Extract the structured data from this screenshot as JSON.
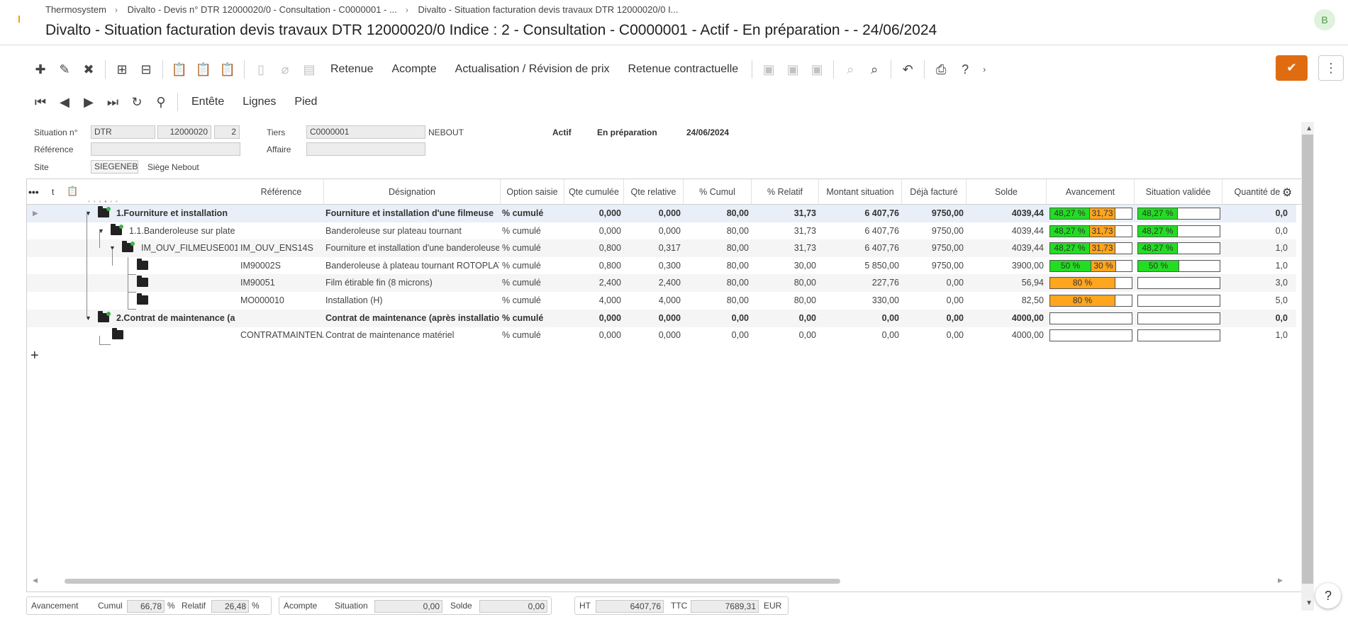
{
  "breadcrumb": [
    "Thermosystem",
    "Divalto - Devis n° DTR 12000020/0 - Consultation - C0000001 - ...",
    "Divalto - Situation facturation devis travaux DTR 12000020/0 I..."
  ],
  "title": "Divalto - Situation facturation devis travaux DTR 12000020/0 Indice : 2 - Consultation - C0000001 - Actif - En préparation - - 24/06/2024",
  "user_initial": "B",
  "toolbar1": {
    "retenue": "Retenue",
    "acompte": "Acompte",
    "actualisation": "Actualisation / Révision de prix",
    "retenue_contractuelle": "Retenue contractuelle"
  },
  "toolbar2": {
    "entete": "Entête",
    "lignes": "Lignes",
    "pied": "Pied"
  },
  "form": {
    "situation_label": "Situation n°",
    "situation_type": "DTR",
    "situation_num": "12000020",
    "situation_index": "2",
    "tiers_label": "Tiers",
    "tiers_code": "C0000001",
    "tiers_name": "NEBOUT",
    "status1": "Actif",
    "status2": "En préparation",
    "date": "24/06/2024",
    "reference_label": "Référence",
    "reference_value": "",
    "affaire_label": "Affaire",
    "affaire_value": "",
    "site_label": "Site",
    "site_code": "SIEGENEB",
    "site_name": "Siège Nebout"
  },
  "grid": {
    "tool_labels": {
      "more": "•••",
      "t": "t"
    },
    "columns": [
      "Référence",
      "Désignation",
      "Option saisie",
      "Qte cumulée",
      "Qte relative",
      "% Cumul",
      "% Relatif",
      "Montant situation",
      "Déjà facturé",
      "Solde",
      "Avancement",
      "Situation validée",
      "Quantité de"
    ],
    "rows": [
      {
        "tree": "1.Fourniture et installation",
        "ref": "",
        "des": "Fourniture et installation d'une filmeuse",
        "opt": "% cumulé",
        "qc": "0,000",
        "qr": "0,000",
        "pc": "80,00",
        "pr": "31,73",
        "mont": "6 407,76",
        "deja": "9750,00",
        "solde": "4039,44",
        "av": {
          "g": 48.27,
          "o": 31.73,
          "gl": "48,27 %",
          "ol": "31,73"
        },
        "sv": {
          "g": 48.27,
          "gl": "48,27 %"
        },
        "qd": "0,0",
        "bold": true
      },
      {
        "tree": "1.1.Banderoleuse sur plate",
        "ref": "",
        "des": "Banderoleuse sur plateau tournant",
        "opt": "% cumulé",
        "qc": "0,000",
        "qr": "0,000",
        "pc": "80,00",
        "pr": "31,73",
        "mont": "6 407,76",
        "deja": "9750,00",
        "solde": "4039,44",
        "av": {
          "g": 48.27,
          "o": 31.73,
          "gl": "48,27 %",
          "ol": "31,73"
        },
        "sv": {
          "g": 48.27,
          "gl": "48,27 %"
        },
        "qd": "0,0",
        "bold": false
      },
      {
        "tree": "IM_OUV_FILMEUSE001",
        "ref": "IM_OUV_ENS14S",
        "des": "Fourniture et installation d'une banderoleuse",
        "opt": "% cumulé",
        "qc": "0,800",
        "qr": "0,317",
        "pc": "80,00",
        "pr": "31,73",
        "mont": "6 407,76",
        "deja": "9750,00",
        "solde": "4039,44",
        "av": {
          "g": 48.27,
          "o": 31.73,
          "gl": "48,27 %",
          "ol": "31,73"
        },
        "sv": {
          "g": 48.27,
          "gl": "48,27 %"
        },
        "qd": "1,0",
        "bold": false
      },
      {
        "tree": "",
        "ref": "IM90002S",
        "des": "Banderoleuse à plateau tournant ROTOPLAT",
        "opt": "% cumulé",
        "qc": "0,800",
        "qr": "0,300",
        "pc": "80,00",
        "pr": "30,00",
        "mont": "5 850,00",
        "deja": "9750,00",
        "solde": "3900,00",
        "av": {
          "g": 50,
          "o": 30,
          "gl": "50 %",
          "ol": "30 %"
        },
        "sv": {
          "g": 50,
          "gl": "50 %"
        },
        "qd": "1,0",
        "bold": false
      },
      {
        "tree": "",
        "ref": "IM90051",
        "des": "Film étirable fin (8 microns)",
        "opt": "% cumulé",
        "qc": "2,400",
        "qr": "2,400",
        "pc": "80,00",
        "pr": "80,00",
        "mont": "227,76",
        "deja": "0,00",
        "solde": "56,94",
        "av": {
          "g": 0,
          "o": 80,
          "gl": "",
          "ol": "80 %"
        },
        "sv": {
          "g": 0,
          "gl": ""
        },
        "qd": "3,0",
        "bold": false
      },
      {
        "tree": "",
        "ref": "MO000010",
        "des": "Installation (H)",
        "opt": "% cumulé",
        "qc": "4,000",
        "qr": "4,000",
        "pc": "80,00",
        "pr": "80,00",
        "mont": "330,00",
        "deja": "0,00",
        "solde": "82,50",
        "av": {
          "g": 0,
          "o": 80,
          "gl": "",
          "ol": "80 %"
        },
        "sv": {
          "g": 0,
          "gl": ""
        },
        "qd": "5,0",
        "bold": false
      },
      {
        "tree": "2.Contrat de maintenance (a",
        "ref": "",
        "des": "Contrat de maintenance (après installation",
        "opt": "% cumulé",
        "qc": "0,000",
        "qr": "0,000",
        "pc": "0,00",
        "pr": "0,00",
        "mont": "0,00",
        "deja": "0,00",
        "solde": "4000,00",
        "av": {
          "g": 0,
          "o": 0,
          "gl": "",
          "ol": ""
        },
        "sv": {
          "g": 0,
          "gl": ""
        },
        "qd": "0,0",
        "bold": true
      },
      {
        "tree": "",
        "ref": "CONTRATMAINTENAN",
        "des": "Contrat de maintenance matériel",
        "opt": "% cumulé",
        "qc": "0,000",
        "qr": "0,000",
        "pc": "0,00",
        "pr": "0,00",
        "mont": "0,00",
        "deja": "0,00",
        "solde": "4000,00",
        "av": {
          "g": 0,
          "o": 0,
          "gl": "",
          "ol": ""
        },
        "sv": {
          "g": 0,
          "gl": ""
        },
        "qd": "1,0",
        "bold": false
      }
    ]
  },
  "footer": {
    "avancement_label": "Avancement",
    "cumul_label": "Cumul",
    "cumul_value": "66,78",
    "pct1": "%",
    "relatif_label": "Relatif",
    "relatif_value": "26,48",
    "pct2": "%",
    "acompte_label": "Acompte",
    "situation_label": "Situation",
    "situation_value": "0,00",
    "solde_label": "Solde",
    "solde_value": "0,00",
    "ht_label": "HT",
    "ht_value": "6407,76",
    "ttc_label": "TTC",
    "ttc_value": "7689,31",
    "currency": "EUR"
  },
  "colors": {
    "accent": "#e06c12",
    "progress_green": "#22dd22",
    "progress_orange": "#ffa51e",
    "selected_row": "#e9eff9"
  },
  "icons": [
    "add-icon",
    "edit-icon",
    "delete-icon",
    "expand-all-icon",
    "collapse-all-icon",
    "paste-icon",
    "copy-icon",
    "clipboard-icon",
    "attach-icon",
    "save-icon",
    "search-icon",
    "zoom-in-icon",
    "undo-icon",
    "print-icon",
    "help-icon",
    "first-icon",
    "previous-icon",
    "next-icon",
    "last-icon",
    "refresh-icon",
    "binoculars-icon",
    "settings-icon",
    "folder-icon"
  ]
}
